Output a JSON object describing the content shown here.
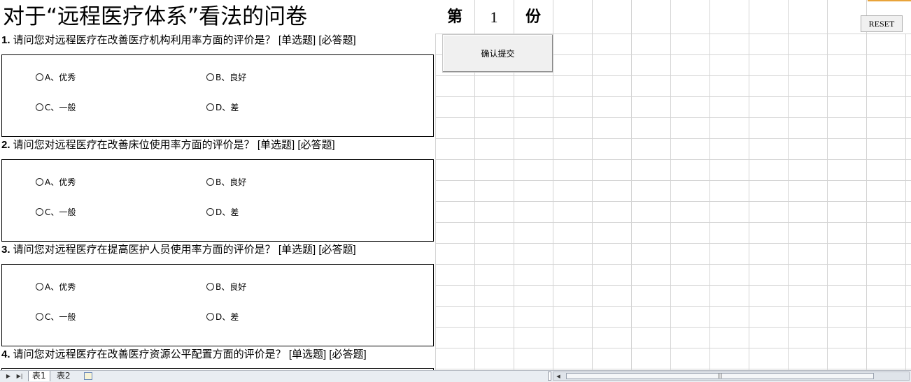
{
  "title": "对于“远程医疗体系”看法的问卷",
  "copy": {
    "prefix": "第",
    "number": "1",
    "suffix": "份"
  },
  "buttons": {
    "submit": "确认提交",
    "reset": "RESET"
  },
  "questions": [
    {
      "num": "1.",
      "text": " 请问您对远程医疗在改善医疗机构利用率方面的评价是？ [单选题] [必答题]",
      "options": [
        "A、优秀",
        "B、良好",
        "C、一般",
        "D、差"
      ]
    },
    {
      "num": "2.",
      "text": " 请问您对远程医疗在改善床位使用率方面的评价是？ [单选题] [必答题]",
      "options": [
        "A、优秀",
        "B、良好",
        "C、一般",
        "D、差"
      ]
    },
    {
      "num": "3.",
      "text": " 请问您对远程医疗在提高医护人员使用率方面的评价是？ [单选题] [必答题]",
      "options": [
        "A、优秀",
        "B、良好",
        "C、一般",
        "D、差"
      ]
    },
    {
      "num": "4.",
      "text": " 请问您对远程医疗在改善医疗资源公平配置方面的评价是？ [单选题] [必答题]"
    }
  ],
  "sheet_tabs": [
    "表1",
    "表2"
  ],
  "icons": {
    "nav_next": "play-icon",
    "nav_last": "last-icon",
    "new_sheet": "new-sheet-icon"
  }
}
